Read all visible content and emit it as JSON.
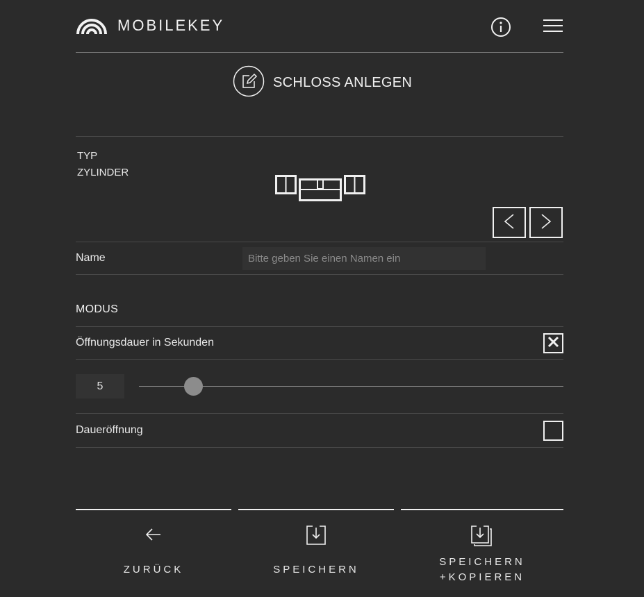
{
  "header": {
    "logo_text": "MOBILEKEY",
    "info_icon": "info-icon",
    "menu_icon": "hamburger-menu-icon"
  },
  "title": {
    "icon": "edit-icon",
    "text": "SCHLOSS ANLEGEN"
  },
  "type": {
    "label": "TYP",
    "value": "ZYLINDER",
    "icon": "cylinder-lock-icon",
    "prev_icon": "chevron-left-icon",
    "next_icon": "chevron-right-icon"
  },
  "name": {
    "label": "Name",
    "value": "",
    "placeholder": "Bitte geben Sie einen Namen ein"
  },
  "modus": {
    "label": "MODUS",
    "duration_label": "Öffnungsdauer in Sekunden",
    "duration_checked": true,
    "slider_value": "5",
    "slider_min": 0,
    "slider_max": 60,
    "permanent_label": "Daueröffnung",
    "permanent_checked": false
  },
  "footer": {
    "back_label": "ZURÜCK",
    "save_label": "SPEICHERN",
    "save_copy_line1": "SPEICHERN",
    "save_copy_line2": "+KOPIEREN"
  },
  "colors": {
    "background": "#2b2b2b",
    "foreground": "#f0f0f0",
    "divider": "#4a4a4a",
    "input_bg": "#323232",
    "slider_thumb": "#8c8c8c"
  }
}
